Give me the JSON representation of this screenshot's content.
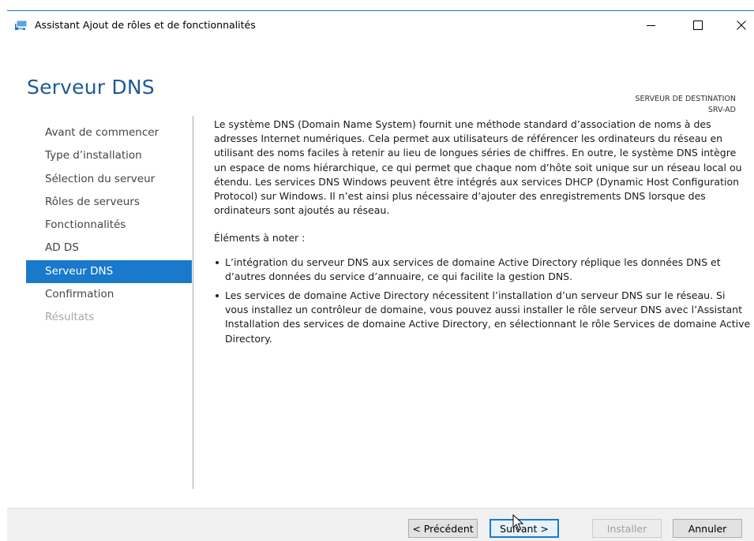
{
  "window": {
    "title": "Assistant Ajout de rôles et de fonctionnalités",
    "controls": {
      "minimize": "minimize",
      "maximize": "maximize",
      "close": "close"
    }
  },
  "header": {
    "page_title": "Serveur DNS",
    "destination_label": "SERVEUR DE DESTINATION",
    "destination_value": "SRV-AD"
  },
  "nav": {
    "items": [
      {
        "label": "Avant de commencer",
        "state": "normal"
      },
      {
        "label": "Type d’installation",
        "state": "normal"
      },
      {
        "label": "Sélection du serveur",
        "state": "normal"
      },
      {
        "label": "Rôles de serveurs",
        "state": "normal"
      },
      {
        "label": "Fonctionnalités",
        "state": "normal"
      },
      {
        "label": "AD DS",
        "state": "normal"
      },
      {
        "label": "Serveur DNS",
        "state": "active"
      },
      {
        "label": "Confirmation",
        "state": "normal"
      },
      {
        "label": "Résultats",
        "state": "disabled"
      }
    ]
  },
  "content": {
    "description": "Le système DNS (Domain Name System) fournit une méthode standard d’association de noms à des adresses Internet numériques. Cela permet aux utilisateurs de référencer les ordinateurs du réseau en utilisant des noms faciles à retenir au lieu de longues séries de chiffres. En outre, le système DNS intègre un espace de noms hiérarchique, ce qui permet que chaque nom d’hôte soit unique sur un réseau local ou étendu. Les services DNS Windows peuvent être intégrés aux services DHCP (Dynamic Host Configuration Protocol) sur Windows. Il n’est ainsi plus nécessaire d’ajouter des enregistrements DNS lorsque des ordinateurs sont ajoutés au réseau.",
    "notes_title": "Éléments à noter :",
    "notes": [
      "L’intégration du serveur DNS aux services de domaine Active Directory réplique les données DNS et d’autres données du service d’annuaire, ce qui facilite la gestion DNS.",
      "Les services de domaine Active Directory nécessitent l’installation d’un serveur DNS sur le réseau. Si vous installez un contrôleur de domaine, vous pouvez aussi installer le rôle serveur DNS avec l’Assistant Installation des services de domaine Active Directory, en sélectionnant le rôle Services de domaine Active Directory."
    ]
  },
  "footer": {
    "prev_label": "< Précédent",
    "next_label": "Suivant >",
    "install_label": "Installer",
    "cancel_label": "Annuler"
  },
  "colors": {
    "accent": "#1979ca",
    "title": "#1c5a97",
    "disabled_text": "#a8a8a8"
  }
}
